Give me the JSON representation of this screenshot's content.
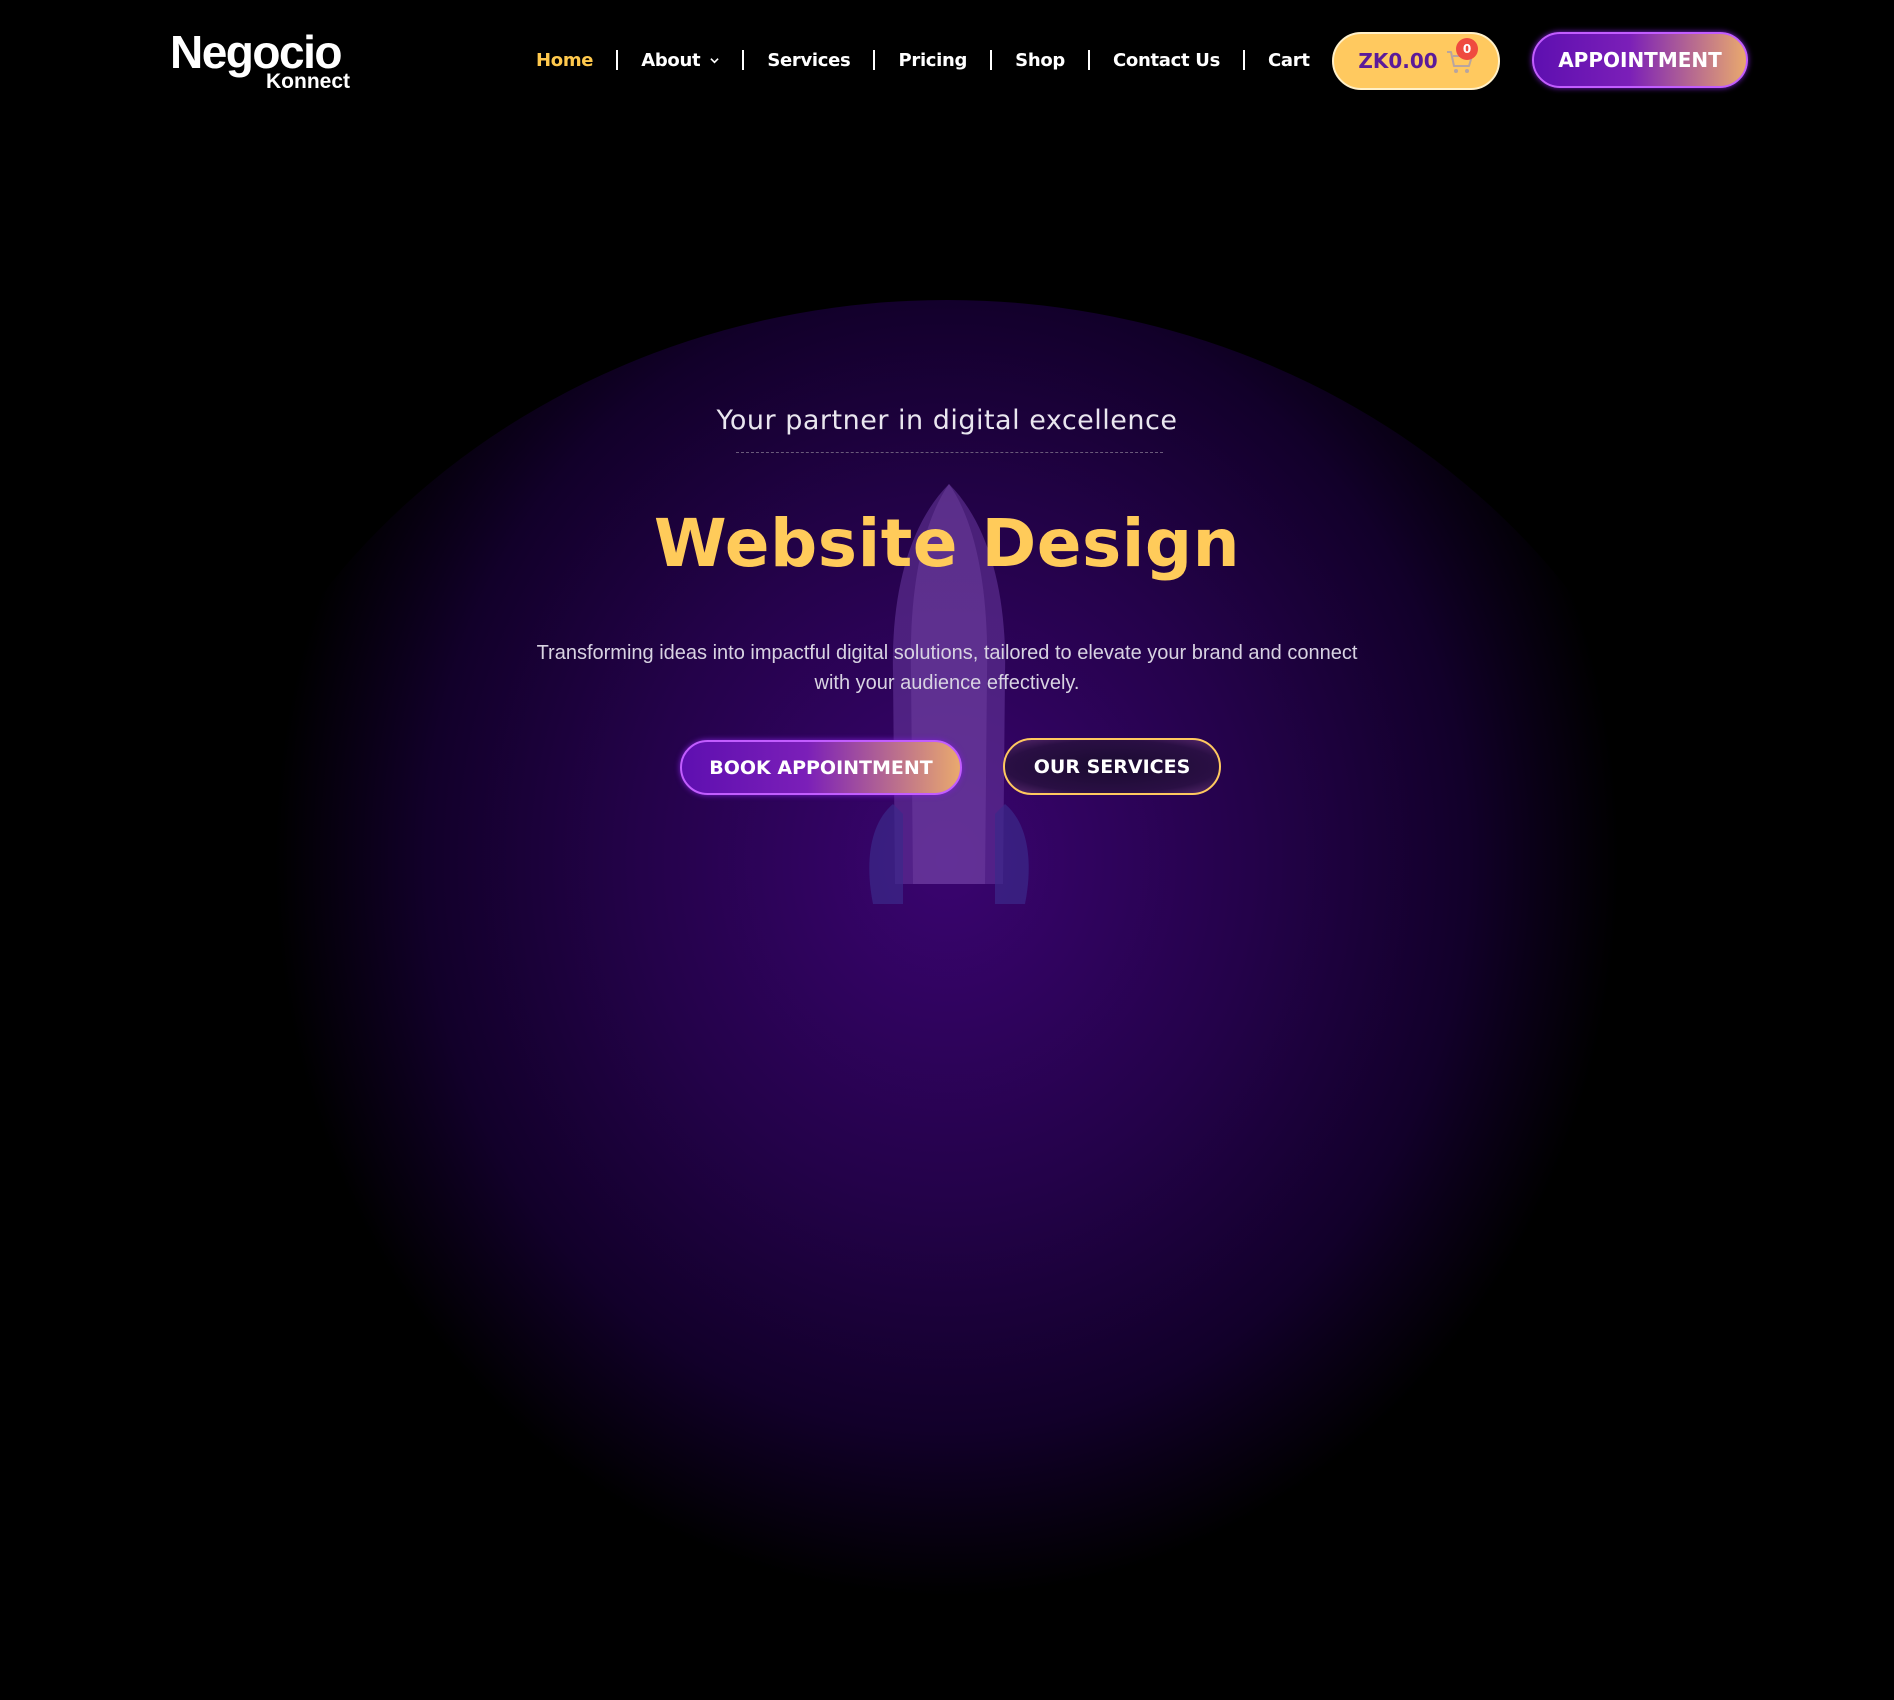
{
  "brand": {
    "name_line1": "Negocio",
    "name_line2": "Konnect"
  },
  "nav": {
    "items": [
      {
        "label": "Home",
        "active": true
      },
      {
        "label": "About",
        "has_dropdown": true
      },
      {
        "label": "Services"
      },
      {
        "label": "Pricing"
      },
      {
        "label": "Shop"
      },
      {
        "label": "Contact Us"
      },
      {
        "label": "Cart"
      }
    ]
  },
  "cart": {
    "amount": "ZK0.00",
    "count": "0",
    "icon": "cart-icon"
  },
  "header_cta": {
    "label": "APPOINTMENT"
  },
  "hero": {
    "tagline": "Your partner in digital excellence",
    "headline": "Website Design",
    "description": "Transforming ideas into impactful digital solutions, tailored to elevate your brand and connect with your audience effectively.",
    "primary_button": "BOOK APPOINTMENT",
    "secondary_button": "OUR SERVICES",
    "illustration": "rocket-illustration"
  },
  "colors": {
    "accent_yellow": "#ffc94d",
    "accent_purple": "#5e0fb0",
    "background": "#000000"
  }
}
